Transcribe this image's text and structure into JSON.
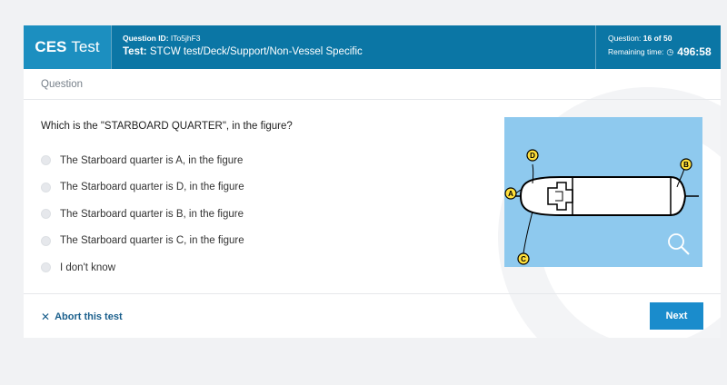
{
  "header": {
    "brand_bold": "CES",
    "brand_rest": "Test",
    "question_id_label": "Question ID:",
    "question_id": "ITo5jhF3",
    "test_label": "Test:",
    "test_name": "STCW test/Deck/Support/Non-Vessel Specific",
    "question_label": "Question:",
    "question_progress": "16 of 50",
    "remaining_label": "Remaining time:",
    "clock_icon": "clock-icon",
    "remaining_time": "496:58"
  },
  "section_label": "Question",
  "question": "Which is the \"STARBOARD QUARTER\", in the figure?",
  "options": [
    "The Starboard quarter is A, in the figure",
    "The Starboard quarter is D, in the figure",
    "The Starboard quarter is B, in the figure",
    "The Starboard quarter is C, in the figure",
    "I don't know"
  ],
  "figure": {
    "labels": {
      "a": "A",
      "b": "B",
      "c": "C",
      "d": "D"
    },
    "background": "#8ec9ee",
    "zoom_icon": "magnifier-icon"
  },
  "footer": {
    "abort_icon": "close-icon",
    "abort_label": "Abort this test",
    "next_label": "Next"
  },
  "colors": {
    "header": "#0b76a5",
    "brand": "#1c8fc0",
    "button": "#1a8ccc",
    "link": "#1a5f8c"
  }
}
